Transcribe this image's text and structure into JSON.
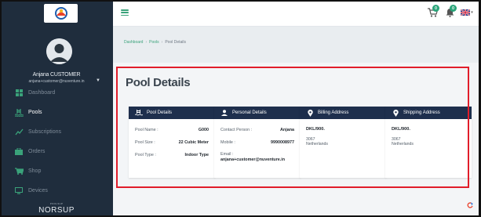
{
  "user": {
    "name": "Anjana CUSTOMER",
    "email": "anjana+customer@nuventure.in"
  },
  "sidebar": {
    "items": [
      {
        "label": "Dashboard",
        "icon": "dashboard-icon",
        "active": false
      },
      {
        "label": "Pools",
        "icon": "pool-icon",
        "active": true
      },
      {
        "label": "Subscriptions",
        "icon": "subscriptions-icon",
        "active": false
      },
      {
        "label": "Orders",
        "icon": "orders-icon",
        "active": false
      },
      {
        "label": "Shop",
        "icon": "shop-icon",
        "active": false
      },
      {
        "label": "Devices",
        "icon": "devices-icon",
        "active": false
      }
    ],
    "brand_small": "POOLSUP",
    "brand_big": "NORSUP"
  },
  "topbar": {
    "cart_badge": "0",
    "notification_badge": "0",
    "language_icon": "uk-flag-icon"
  },
  "breadcrumb": [
    "Dashboard",
    "Pools",
    "Pool Details"
  ],
  "page": {
    "title": "Pool Details"
  },
  "cards": {
    "pool": {
      "title": "Pool Details",
      "rows": [
        {
          "key": "Pool Name :",
          "value": "G000"
        },
        {
          "key": "Pool Size :",
          "value": "22 Cubic Meter"
        },
        {
          "key": "Pool Type :",
          "value": "Indoor Type"
        }
      ]
    },
    "personal": {
      "title": "Personal Details",
      "contact_key": "Contact Person :",
      "contact_value": "Anjana",
      "mobile_key": "Mobile :",
      "mobile_value": "9990008977",
      "email_key": "Email :",
      "email_value": "anjana+customer@nuventure.in"
    },
    "billing": {
      "title": "Billing Address",
      "line1": "DKL/900.",
      "line2": "3067",
      "line3": "Netherlands"
    },
    "shipping": {
      "title": "Shipping Address",
      "line1": "DKL/900.",
      "line2": "3067",
      "line3": "Netherlands"
    }
  },
  "colors": {
    "sidebar_bg": "#1f2d3d",
    "card_header": "#1e2f4d",
    "accent_green": "#3aa27a",
    "highlight_red": "#e11d2a"
  }
}
